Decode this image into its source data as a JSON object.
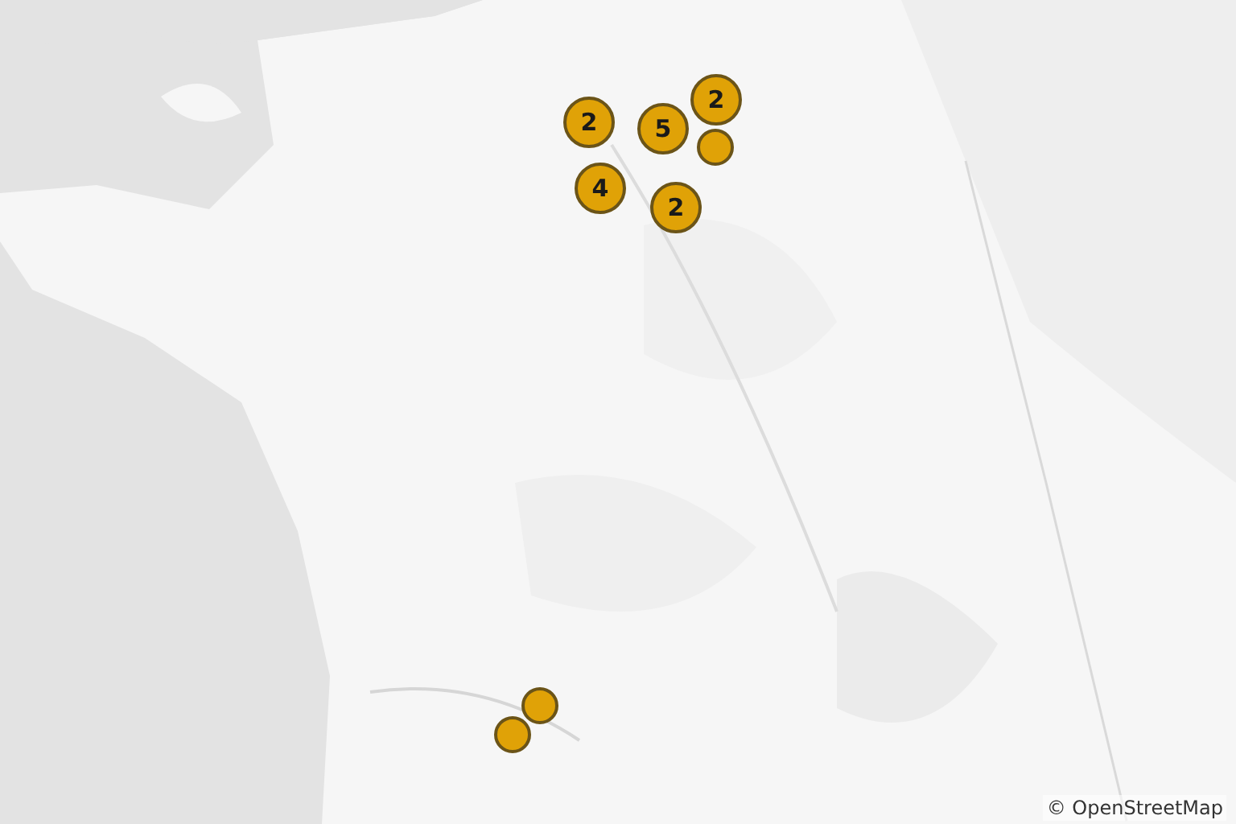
{
  "markers": [
    {
      "kind": "cluster",
      "count": "2"
    },
    {
      "kind": "cluster",
      "count": "2"
    },
    {
      "kind": "cluster",
      "count": "5"
    },
    {
      "kind": "point"
    },
    {
      "kind": "cluster",
      "count": "4"
    },
    {
      "kind": "cluster",
      "count": "2"
    },
    {
      "kind": "point"
    },
    {
      "kind": "point"
    }
  ],
  "attribution": "© OpenStreetMap"
}
